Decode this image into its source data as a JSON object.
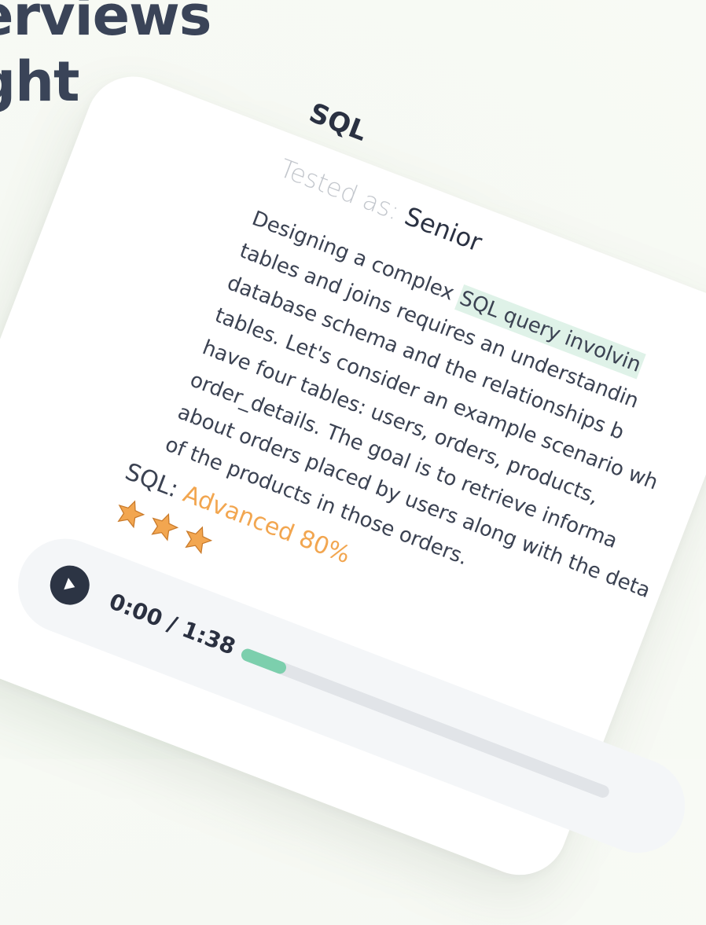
{
  "headline": {
    "line1": "erviews",
    "line2": "ght"
  },
  "card": {
    "title": "SQL",
    "tested_label": "Tested as:",
    "tested_level": "Senior",
    "description_lines": [
      {
        "before": "Designing a complex ",
        "highlight": "SQL query involvin",
        "after": ""
      },
      {
        "before": "tables and joins requires an understandin",
        "highlight": "",
        "after": ""
      },
      {
        "before": "database schema and the relationships b",
        "highlight": "",
        "after": ""
      },
      {
        "before": "tables. Let's consider an example scenario wh",
        "highlight": "",
        "after": ""
      },
      {
        "before": "have four tables: users, orders, products,",
        "highlight": "",
        "after": ""
      },
      {
        "before": "order_details. The goal is to retrieve informa",
        "highlight": "",
        "after": ""
      },
      {
        "before": "about orders placed by users along with the deta",
        "highlight": "",
        "after": ""
      },
      {
        "before": "of the products in those orders.",
        "highlight": "",
        "after": ""
      }
    ],
    "skill_label": "SQL:",
    "skill_level": "Advanced 80%",
    "stars": 3,
    "star_color": "#f2a650"
  },
  "player": {
    "time": "0:00 / 1:38",
    "progress": 0.12,
    "progress_color": "#7ccfad"
  },
  "colors": {
    "accent_arrow": "#5e2bb3",
    "text_dark": "#2a3142"
  }
}
